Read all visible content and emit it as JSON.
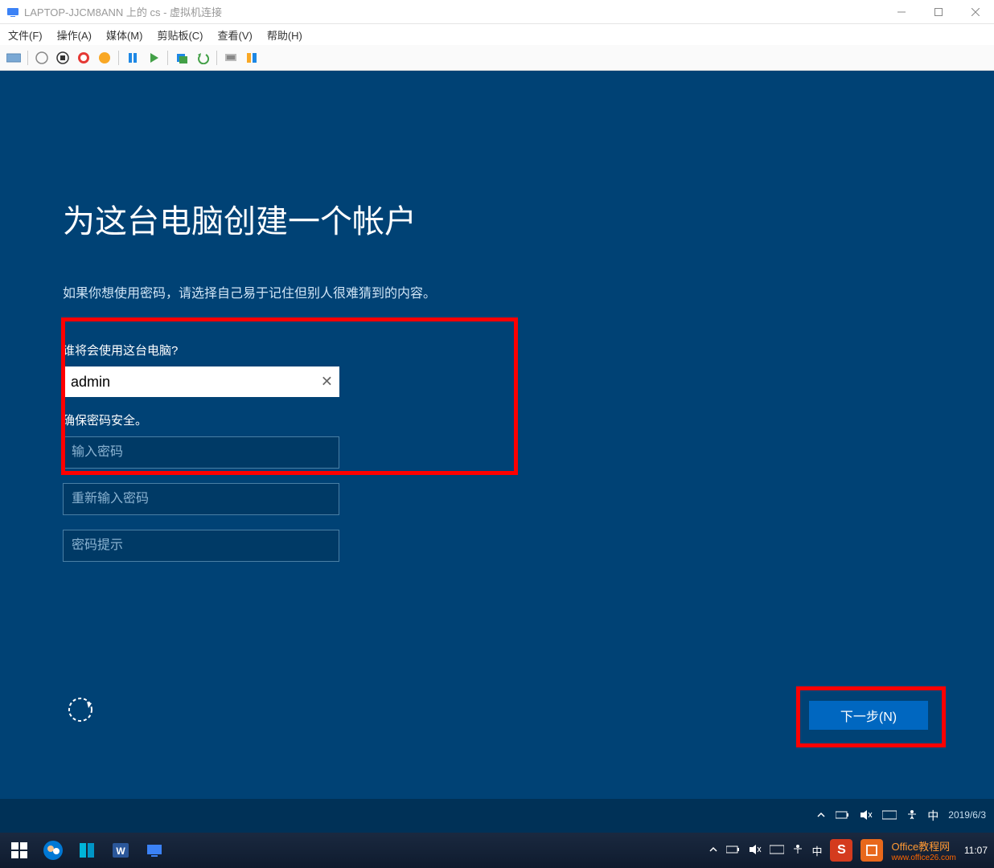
{
  "window": {
    "title": "LAPTOP-JJCM8ANN 上的 cs - 虚拟机连接"
  },
  "menu": {
    "file": "文件(F)",
    "action": "操作(A)",
    "media": "媒体(M)",
    "clipboard": "剪贴板(C)",
    "view": "查看(V)",
    "help": "帮助(H)"
  },
  "oobe": {
    "title": "为这台电脑创建一个帐户",
    "subtitle": "如果你想使用密码，请选择自己易于记住但别人很难猜到的内容。",
    "who_label": "谁将会使用这台电脑?",
    "username_value": "admin",
    "password_section_label": "确保密码安全。",
    "password_placeholder": "输入密码",
    "reenter_placeholder": "重新输入密码",
    "hint_placeholder": "密码提示",
    "next_button": "下一步(N)"
  },
  "vm_taskbar": {
    "ime": "中",
    "date": "2019/6/3"
  },
  "host_taskbar": {
    "time": "11:07",
    "ime": "中",
    "s_label": "S"
  },
  "watermark": {
    "main": "Office教程网",
    "sub": "www.office26.com"
  }
}
